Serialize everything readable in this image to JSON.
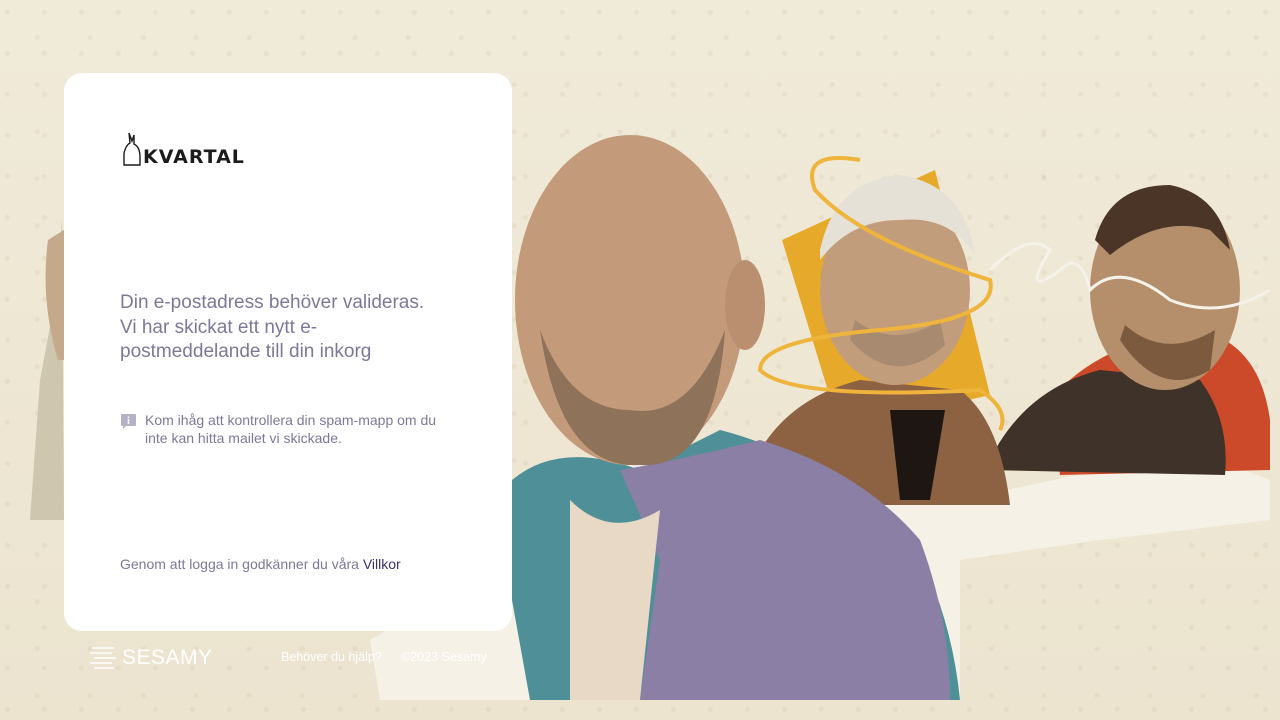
{
  "brand": {
    "logo_text": "KVARTAL",
    "accent_color": "#3b2f6e",
    "text_color": "#7e7898"
  },
  "card": {
    "heading_lines": [
      "Din e-postadress behöver valideras.",
      "Vi har skickat ett nytt e-",
      "postmeddelande till din inkorg"
    ],
    "info_icon": "info-icon",
    "info_text": "Kom ihåg att kontrollera din spam-mapp om du inte kan hitta mailet vi skickade.",
    "terms_text": "Genom att logga in godkänner du våra ",
    "terms_link": "Villkor"
  },
  "footer": {
    "logo_text": "SESAMY",
    "help_link": "Behöver du hjälp?",
    "copyright": "©2023 Sesamy"
  }
}
